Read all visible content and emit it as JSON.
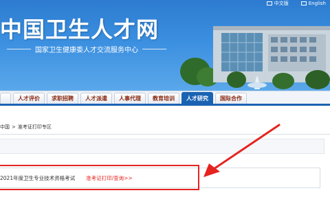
{
  "header": {
    "top_links": [
      {
        "label": "中文版"
      },
      {
        "label": "English"
      }
    ],
    "site_title": "中国卫生人才网",
    "subtitle": "国家卫生健康委人才交流服务中心"
  },
  "nav": {
    "items": [
      {
        "label": "",
        "active": false
      },
      {
        "label": "人才评价",
        "active": false
      },
      {
        "label": "求职招聘",
        "active": false
      },
      {
        "label": "人才派遣",
        "active": false
      },
      {
        "label": "人事代理",
        "active": false
      },
      {
        "label": "教育培训",
        "active": false
      },
      {
        "label": "人才研究",
        "active": true
      },
      {
        "label": "国际合作",
        "active": false
      }
    ]
  },
  "breadcrumb": {
    "home_fragment": "中国",
    "separator": ">",
    "current": "准考证打印专区"
  },
  "exam": {
    "title": "2021年度卫生专业技术资格考试",
    "link": "准考证打印/查询>>"
  },
  "colors": {
    "header_blue": "#2c7bd0",
    "nav_active": "#1a63b3",
    "highlight_red": "#e5241f"
  }
}
